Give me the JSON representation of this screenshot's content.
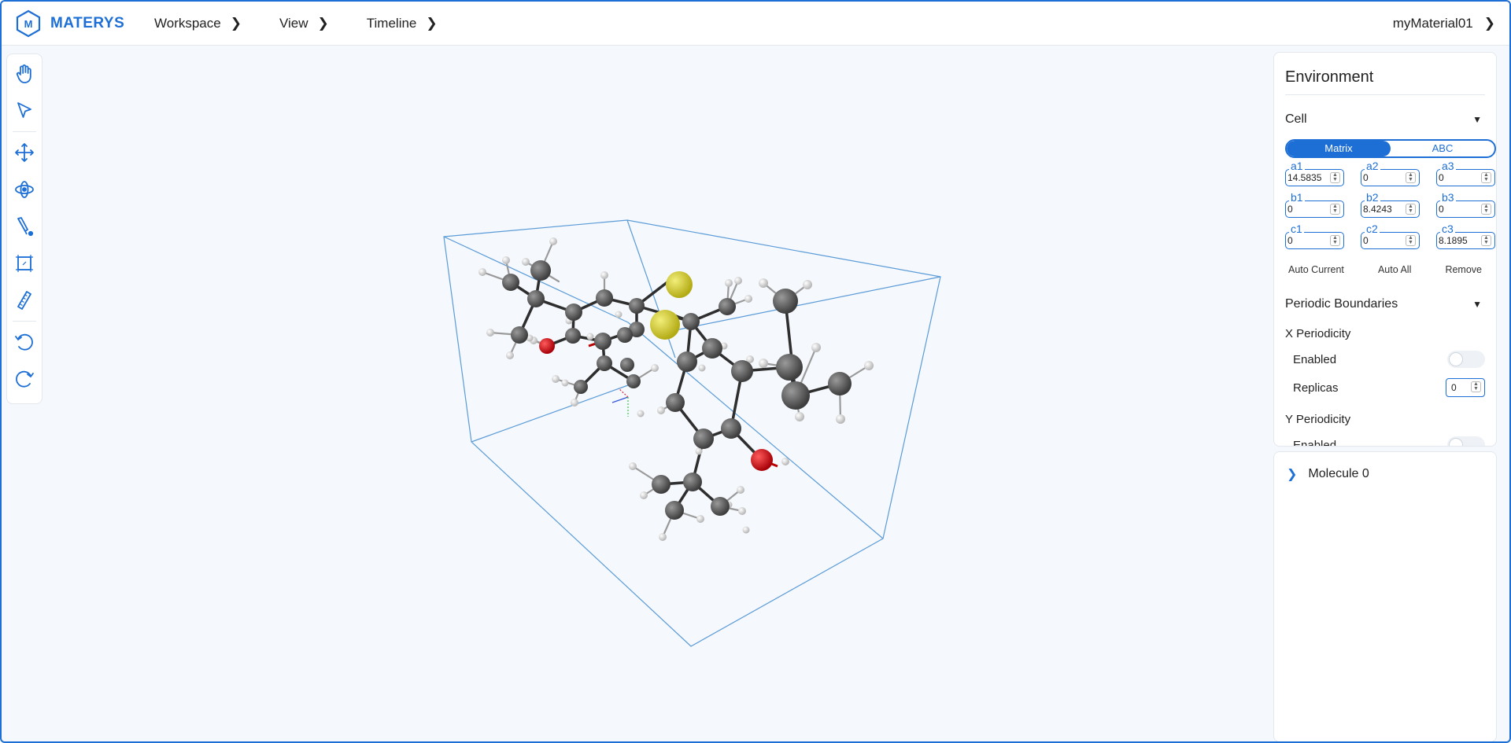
{
  "app": {
    "name": "MATERYS",
    "logo_letters": "M"
  },
  "nav": {
    "items": [
      {
        "label": "Workspace"
      },
      {
        "label": "View"
      },
      {
        "label": "Timeline"
      }
    ],
    "material": "myMaterial01"
  },
  "toolbar": {
    "tools": [
      "hand-icon",
      "pointer-icon",
      "move-icon",
      "orbit-icon",
      "pen-icon",
      "cell-icon",
      "ruler-icon",
      "undo-icon",
      "redo-icon"
    ]
  },
  "panel": {
    "title": "Environment",
    "cell": {
      "label": "Cell",
      "modes": [
        "Matrix",
        "ABC"
      ],
      "active_mode": "Matrix",
      "matrix": [
        {
          "label": "a1",
          "value": "14.5835"
        },
        {
          "label": "a2",
          "value": "0"
        },
        {
          "label": "a3",
          "value": "0"
        },
        {
          "label": "b1",
          "value": "0"
        },
        {
          "label": "b2",
          "value": "8.4243"
        },
        {
          "label": "b3",
          "value": "0"
        },
        {
          "label": "c1",
          "value": "0"
        },
        {
          "label": "c2",
          "value": "0"
        },
        {
          "label": "c3",
          "value": "8.1895"
        }
      ],
      "actions": [
        "Auto Current",
        "Auto All",
        "Remove"
      ]
    },
    "periodic": {
      "label": "Periodic Boundaries",
      "x": {
        "label": "X Periodicity",
        "enabled_label": "Enabled",
        "replicas_label": "Replicas",
        "replicas": "0"
      },
      "y": {
        "label": "Y Periodicity",
        "enabled_label": "Enabled"
      }
    }
  },
  "tree": {
    "items": [
      {
        "label": "Molecule 0"
      }
    ]
  },
  "colors": {
    "accent": "#1d6fd6",
    "carbon": "#555555",
    "hydrogen": "#d8d8d8",
    "sulfur": "#c9c22a",
    "oxygen": "#c0000a",
    "cell_box": "#5a9bd8"
  }
}
